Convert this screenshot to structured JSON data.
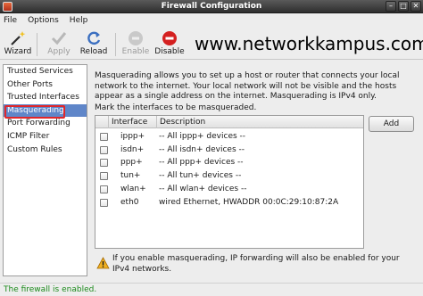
{
  "window": {
    "title": "Firewall Configuration"
  },
  "menu": {
    "items": [
      "File",
      "Options",
      "Help"
    ]
  },
  "toolbar": {
    "wizard": "Wizard",
    "apply": "Apply",
    "reload": "Reload",
    "enable": "Enable",
    "disable": "Disable"
  },
  "watermark": "www.networkkampus.com",
  "sidebar": {
    "items": [
      {
        "label": "Trusted Services"
      },
      {
        "label": "Other Ports"
      },
      {
        "label": "Trusted Interfaces"
      },
      {
        "label": "Masquerading"
      },
      {
        "label": "Port Forwarding"
      },
      {
        "label": "ICMP Filter"
      },
      {
        "label": "Custom Rules"
      }
    ],
    "selected": "Masquerading"
  },
  "main": {
    "description": "Masquerading allows you to set up a host or router that connects your local network to the internet. Your local network will not be visible and the hosts appear as a single address on the internet. Masquerading is IPv4 only.",
    "mark_label": "Mark the interfaces to be masqueraded.",
    "table": {
      "headers": [
        "Interface",
        "Description"
      ],
      "rows": [
        {
          "checked": false,
          "interface": "ippp+",
          "description": "-- All ippp+ devices --"
        },
        {
          "checked": false,
          "interface": "isdn+",
          "description": "-- All isdn+ devices --"
        },
        {
          "checked": false,
          "interface": "ppp+",
          "description": "-- All ppp+ devices --"
        },
        {
          "checked": false,
          "interface": "tun+",
          "description": "-- All tun+ devices --"
        },
        {
          "checked": false,
          "interface": "wlan+",
          "description": "-- All wlan+ devices --"
        },
        {
          "checked": false,
          "interface": "eth0",
          "description": "wired Ethernet, HWADDR 00:0C:29:10:87:2A"
        }
      ]
    },
    "add_button": "Add",
    "warning": "If you enable masquerading, IP forwarding will also be enabled for your IPv4 networks."
  },
  "status": {
    "text": "The firewall is enabled.",
    "color": "#1b8a1b"
  },
  "colors": {
    "selection": "#5f86c9",
    "highlight_ring": "#e0272b"
  }
}
